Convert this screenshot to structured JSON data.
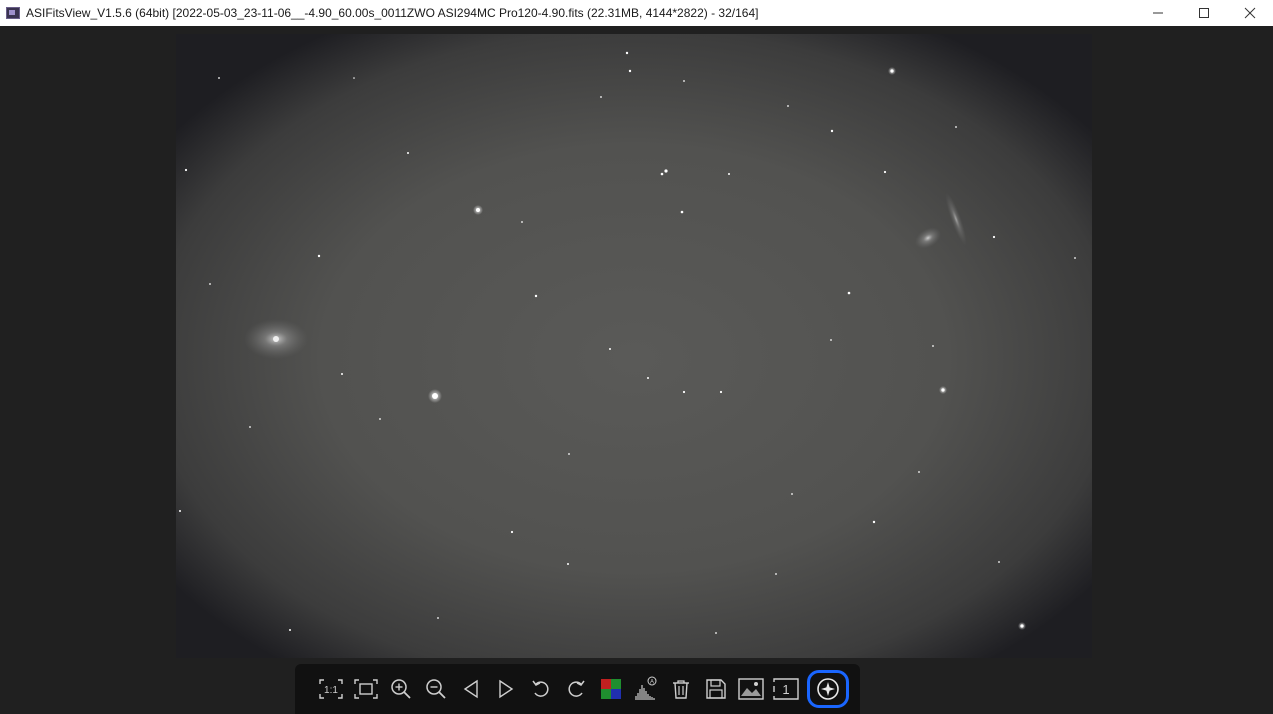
{
  "window": {
    "title": "ASIFitsView_V1.5.6 (64bit) [2022-05-03_23-11-06__-4.90_60.00s_0011ZWO ASI294MC Pro120-4.90.fits (22.31MB, 4144*2822) - 32/164]",
    "controls": {
      "minimize_glyph": "—",
      "maximize_glyph": "☐",
      "close_glyph": "✕"
    }
  },
  "toolbar": {
    "buttons": [
      {
        "name": "actual-size-icon"
      },
      {
        "name": "fit-window-icon"
      },
      {
        "name": "zoom-in-icon"
      },
      {
        "name": "zoom-out-icon"
      },
      {
        "name": "previous-icon"
      },
      {
        "name": "next-icon"
      },
      {
        "name": "rotate-left-icon"
      },
      {
        "name": "rotate-right-icon"
      },
      {
        "name": "debayer-icon"
      },
      {
        "name": "auto-stretch-histogram-icon"
      },
      {
        "name": "delete-icon"
      },
      {
        "name": "save-icon"
      },
      {
        "name": "image-icon"
      },
      {
        "name": "single-frame-icon"
      },
      {
        "name": "star-detect-icon",
        "active": true
      }
    ],
    "highlight_color": "#1a66ff"
  }
}
